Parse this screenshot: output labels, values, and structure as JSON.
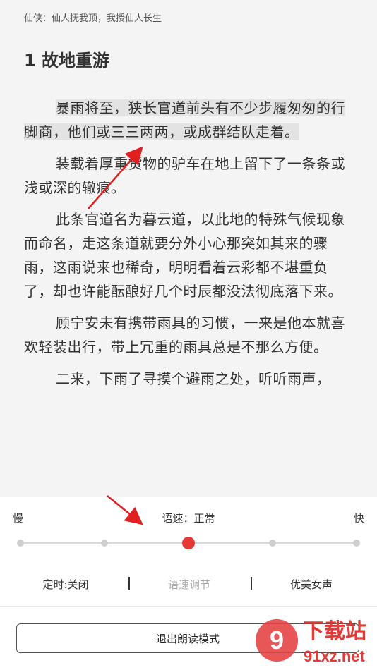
{
  "reader": {
    "book_title": "仙侠：仙人抚我顶，我授仙人长生",
    "chapter_title": "1 故地重游",
    "paragraphs": [
      "暴雨将至，狭长官道前头有不少步履匆匆的行脚商，他们或三三两两，或成群结队走着。",
      "装载着厚重货物的驴车在地上留下了一条条或浅或深的辙痕。",
      "此条官道名为暮云道，以此地的特殊气候现象而命名，走这条道就要分外小心那突如其来的骤雨，这雨说来也稀奇，明明看着云彩都不堪重负了，却也许能酝酿好几个时辰都没法彻底落下来。",
      "顾宁安未有携带雨具的习惯，一来是他本就喜欢轻装出行，带上冗重的雨具总是不那么方便。",
      "二来，下雨了寻摸个避雨之处，听听雨声，"
    ]
  },
  "tts_panel": {
    "slow_label": "慢",
    "fast_label": "快",
    "speed_label": "语速：正常",
    "speed_levels": 5,
    "selected_level": 3,
    "accent_color": "#e53935",
    "timer_label": "定时:关闭",
    "adjust_label": "语速调节",
    "voice_label": "优美女声",
    "exit_label": "退出朗读模式"
  },
  "watermark": {
    "brand": "下载站",
    "domain": "91xz.net",
    "logo_text": "9"
  }
}
